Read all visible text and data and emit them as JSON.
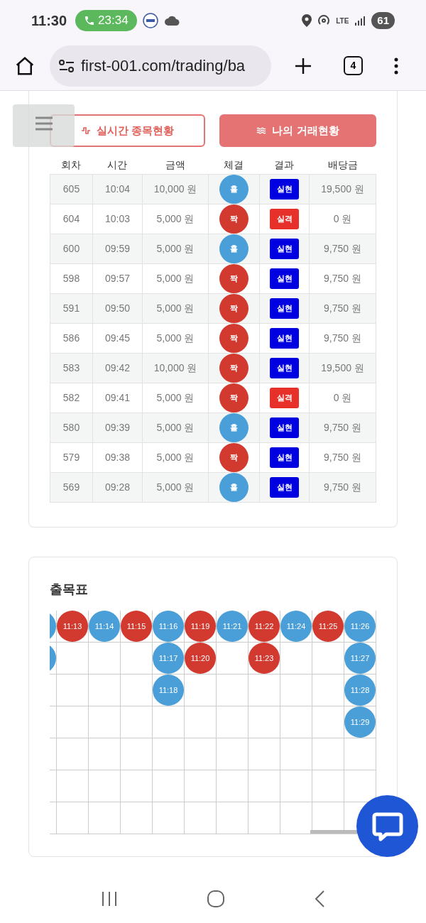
{
  "status_bar": {
    "time": "11:30",
    "call_timer": "23:34",
    "network": "LTE",
    "battery": "61"
  },
  "browser": {
    "url": "first-001.com/trading/ba",
    "tab_count": "4"
  },
  "tabs": [
    {
      "label": "실시간 종목현황",
      "selected": false
    },
    {
      "label": "나의 거래현황",
      "selected": true
    }
  ],
  "table": {
    "columns": [
      "회차",
      "시간",
      "금액",
      "체결",
      "결과",
      "배당금"
    ],
    "rows": [
      {
        "round": "605",
        "time": "10:04",
        "amount": "10,000 원",
        "pick": {
          "label": "홀",
          "color": "#4a9fd8"
        },
        "result": {
          "label": "실현",
          "color": "#0000e0"
        },
        "payout": "19,500 원"
      },
      {
        "round": "604",
        "time": "10:03",
        "amount": "5,000 원",
        "pick": {
          "label": "짝",
          "color": "#d23a30"
        },
        "result": {
          "label": "실격",
          "color": "#e8302a"
        },
        "payout": "0 원"
      },
      {
        "round": "600",
        "time": "09:59",
        "amount": "5,000 원",
        "pick": {
          "label": "홀",
          "color": "#4a9fd8"
        },
        "result": {
          "label": "실현",
          "color": "#0000e0"
        },
        "payout": "9,750 원"
      },
      {
        "round": "598",
        "time": "09:57",
        "amount": "5,000 원",
        "pick": {
          "label": "짝",
          "color": "#d23a30"
        },
        "result": {
          "label": "실현",
          "color": "#0000e0"
        },
        "payout": "9,750 원"
      },
      {
        "round": "591",
        "time": "09:50",
        "amount": "5,000 원",
        "pick": {
          "label": "짝",
          "color": "#d23a30"
        },
        "result": {
          "label": "실현",
          "color": "#0000e0"
        },
        "payout": "9,750 원"
      },
      {
        "round": "586",
        "time": "09:45",
        "amount": "5,000 원",
        "pick": {
          "label": "짝",
          "color": "#d23a30"
        },
        "result": {
          "label": "실현",
          "color": "#0000e0"
        },
        "payout": "9,750 원"
      },
      {
        "round": "583",
        "time": "09:42",
        "amount": "10,000 원",
        "pick": {
          "label": "짝",
          "color": "#d23a30"
        },
        "result": {
          "label": "실현",
          "color": "#0000e0"
        },
        "payout": "19,500 원"
      },
      {
        "round": "582",
        "time": "09:41",
        "amount": "5,000 원",
        "pick": {
          "label": "짝",
          "color": "#d23a30"
        },
        "result": {
          "label": "실격",
          "color": "#e8302a"
        },
        "payout": "0 원"
      },
      {
        "round": "580",
        "time": "09:39",
        "amount": "5,000 원",
        "pick": {
          "label": "홀",
          "color": "#4a9fd8"
        },
        "result": {
          "label": "실현",
          "color": "#0000e0"
        },
        "payout": "9,750 원"
      },
      {
        "round": "579",
        "time": "09:38",
        "amount": "5,000 원",
        "pick": {
          "label": "짝",
          "color": "#d23a30"
        },
        "result": {
          "label": "실현",
          "color": "#0000e0"
        },
        "payout": "9,750 원"
      },
      {
        "round": "569",
        "time": "09:28",
        "amount": "5,000 원",
        "pick": {
          "label": "홀",
          "color": "#4a9fd8"
        },
        "result": {
          "label": "실현",
          "color": "#0000e0"
        },
        "payout": "9,750 원"
      }
    ]
  },
  "bead_table": {
    "title": "출목표",
    "columns": [
      {
        "cells": [
          {
            "color": "#4a9fd8"
          },
          {
            "color": "#4a9fd8"
          }
        ]
      },
      {
        "cells": [
          {
            "label": "11:13",
            "color": "#d23a30"
          }
        ]
      },
      {
        "cells": [
          {
            "label": "11:14",
            "color": "#4a9fd8"
          }
        ]
      },
      {
        "cells": [
          {
            "label": "11:15",
            "color": "#d23a30"
          }
        ]
      },
      {
        "cells": [
          {
            "label": "11:16",
            "color": "#4a9fd8"
          },
          {
            "label": "11:17",
            "color": "#4a9fd8"
          },
          {
            "label": "11:18",
            "color": "#4a9fd8"
          }
        ]
      },
      {
        "cells": [
          {
            "label": "11:19",
            "color": "#d23a30"
          },
          {
            "label": "11:20",
            "color": "#d23a30"
          }
        ]
      },
      {
        "cells": [
          {
            "label": "11:21",
            "color": "#4a9fd8"
          }
        ]
      },
      {
        "cells": [
          {
            "label": "11:22",
            "color": "#d23a30"
          },
          {
            "label": "11:23",
            "color": "#d23a30"
          }
        ]
      },
      {
        "cells": [
          {
            "label": "11:24",
            "color": "#4a9fd8"
          }
        ]
      },
      {
        "cells": [
          {
            "label": "11:25",
            "color": "#d23a30"
          }
        ]
      },
      {
        "cells": [
          {
            "label": "11:26",
            "color": "#4a9fd8"
          },
          {
            "label": "11:27",
            "color": "#4a9fd8"
          },
          {
            "label": "11:28",
            "color": "#4a9fd8"
          },
          {
            "label": "11:29",
            "color": "#4a9fd8"
          }
        ]
      }
    ]
  }
}
